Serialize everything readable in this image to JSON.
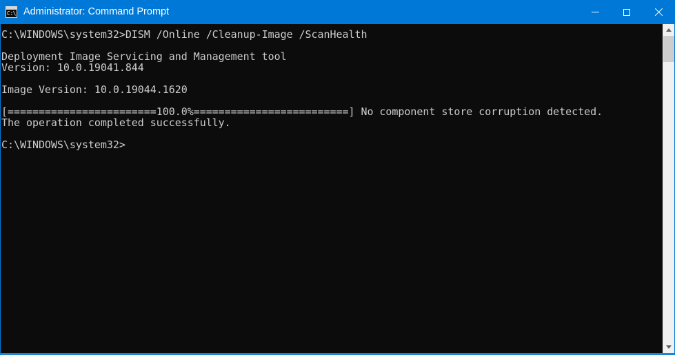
{
  "window": {
    "title": "Administrator: Command Prompt",
    "icon_name": "cmd-console-icon",
    "icon_text": "C:\\",
    "titlebar_color": "#0078d7",
    "console_bg": "#0c0c0c",
    "console_fg": "#cccccc",
    "border_color": "#1a86d9"
  },
  "controls": {
    "minimize_label": "Minimize",
    "maximize_label": "Maximize",
    "close_label": "Close"
  },
  "console": {
    "lines": [
      "C:\\WINDOWS\\system32>DISM /Online /Cleanup-Image /ScanHealth",
      "",
      "Deployment Image Servicing and Management tool",
      "Version: 10.0.19041.844",
      "",
      "Image Version: 10.0.19044.1620",
      "",
      "[========================100.0%=========================] No component store corruption detected.",
      "The operation completed successfully.",
      "",
      "C:\\WINDOWS\\system32>"
    ],
    "command": "DISM /Online /Cleanup-Image /ScanHealth",
    "prompt": "C:\\WINDOWS\\system32>",
    "tool_name": "Deployment Image Servicing and Management tool",
    "version": "Version: 10.0.19041.844",
    "image_version": "Image Version: 10.0.19044.1620",
    "progress_percent": "100.0%",
    "progress_result": "No component store corruption detected.",
    "status": "The operation completed successfully."
  },
  "scrollbar": {
    "up_arrow_name": "scroll-up-arrow",
    "down_arrow_name": "scroll-down-arrow",
    "thumb_name": "scroll-thumb"
  }
}
